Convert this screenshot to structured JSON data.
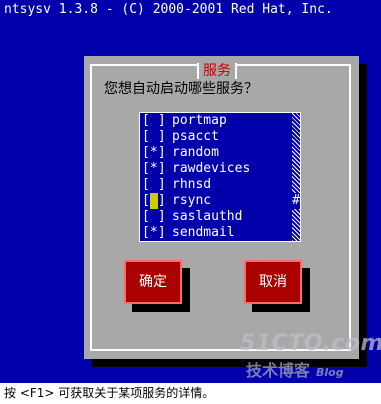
{
  "app": {
    "title": "ntsysv 1.3.8 - (C) 2000-2001 Red Hat, Inc."
  },
  "dialog": {
    "title": "服务",
    "question": "您想自动启动哪些服务？",
    "services": [
      {
        "mark": "[ ]",
        "enabled": false,
        "focused": false,
        "name": "portmap"
      },
      {
        "mark": "[ ]",
        "enabled": false,
        "focused": false,
        "name": "psacct"
      },
      {
        "mark": "[*]",
        "enabled": true,
        "focused": false,
        "name": "random"
      },
      {
        "mark": "[*]",
        "enabled": true,
        "focused": false,
        "name": "rawdevices"
      },
      {
        "mark": "[ ]",
        "enabled": false,
        "focused": false,
        "name": "rhnsd"
      },
      {
        "mark": "[ ]",
        "enabled": false,
        "focused": true,
        "name": "rsync"
      },
      {
        "mark": "[ ]",
        "enabled": false,
        "focused": false,
        "name": "saslauthd"
      },
      {
        "mark": "[*]",
        "enabled": true,
        "focused": false,
        "name": "sendmail"
      }
    ],
    "scroll_thumb": "#",
    "ok_label": "确定",
    "cancel_label": "取消"
  },
  "status_bar": {
    "text": "按 <F1> 可获取关于某项服务的详情。"
  },
  "watermark": {
    "top": "51CTO.com",
    "bottom": "技术博客",
    "blog": "Blog"
  },
  "colors": {
    "screen_bg": "#0000aa",
    "dialog_bg": "#a8a8a8",
    "title_red": "#cc0000",
    "button_bg": "#aa0000",
    "focus_yellow": "#cccc00"
  }
}
